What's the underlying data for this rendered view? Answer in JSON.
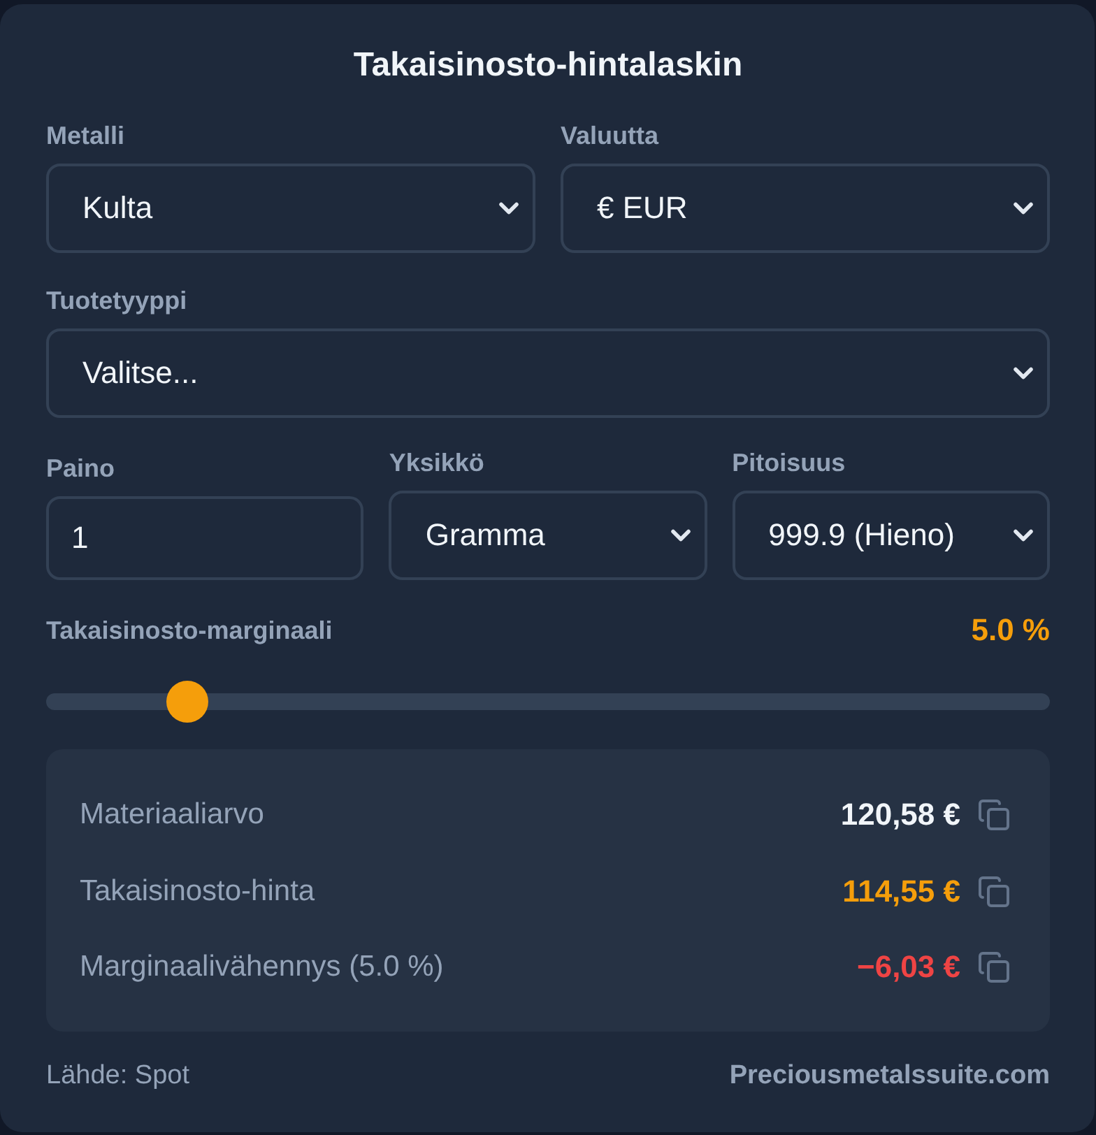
{
  "title": "Takaisinosto-hintalaskin",
  "field_rows": [
    [
      {
        "kind": "select",
        "label": "Metalli",
        "value": "Kulta"
      },
      {
        "kind": "select",
        "label": "Valuutta",
        "value": "€ EUR"
      }
    ],
    [
      {
        "kind": "select",
        "label": "Tuotetyyppi",
        "value": "Valitse..."
      }
    ],
    [
      {
        "kind": "input",
        "label": "Paino",
        "value": "1"
      },
      {
        "kind": "select",
        "label": "Yksikkö",
        "value": "Gramma"
      },
      {
        "kind": "select",
        "label": "Pitoisuus",
        "value": "999.9 (Hieno)"
      }
    ]
  ],
  "margin": {
    "label": "Takaisinosto-marginaali",
    "reading": "5.0 %",
    "level": 0.14
  },
  "results": [
    {
      "label": "Materiaaliarvo",
      "value": "120,58 €",
      "color": "#f1f5f9"
    },
    {
      "label": "Takaisinosto-hinta",
      "value": "114,55 €",
      "color": "#f59e0b"
    },
    {
      "label": "Marginaalivähennys (5.0 %)",
      "value": "−6,03 €",
      "color": "#ef4444"
    }
  ],
  "footer": {
    "source": "Lähde: Spot",
    "brand": "Preciousmetalssuite.com"
  }
}
